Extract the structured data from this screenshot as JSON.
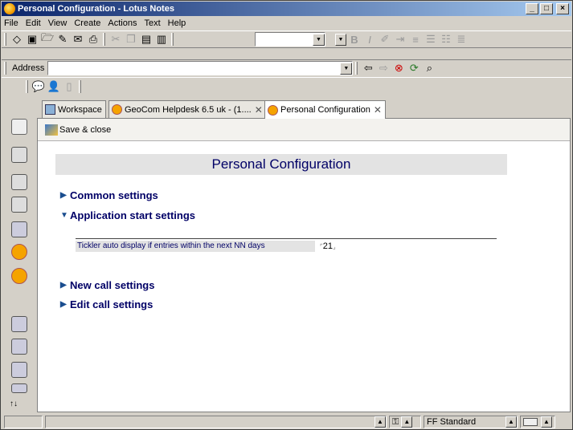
{
  "window": {
    "title": "Personal Configuration - Lotus Notes"
  },
  "menu": [
    "File",
    "Edit",
    "View",
    "Create",
    "Actions",
    "Text",
    "Help"
  ],
  "address": {
    "label": "Address",
    "value": ""
  },
  "tabs": [
    {
      "label": "Workspace",
      "closable": false
    },
    {
      "label": "GeoCom Helpdesk 6.5 uk - (1....",
      "closable": true
    },
    {
      "label": "Personal Configuration",
      "closable": true
    }
  ],
  "actionbar": {
    "save_close": "Save & close"
  },
  "form": {
    "heading": "Personal Configuration",
    "sections": [
      {
        "label": "Common settings",
        "expanded": false
      },
      {
        "label": "Application start settings",
        "expanded": true
      },
      {
        "label": "New call settings",
        "expanded": false
      },
      {
        "label": "Edit call settings",
        "expanded": false
      }
    ],
    "field": {
      "label": "Tickler auto display if entries within the next NN days",
      "value": "21"
    }
  },
  "status": {
    "font": "FF Standard"
  },
  "colors": {
    "heading_text": "#000066",
    "title_start": "#0a246a",
    "title_end": "#a6caf0"
  }
}
